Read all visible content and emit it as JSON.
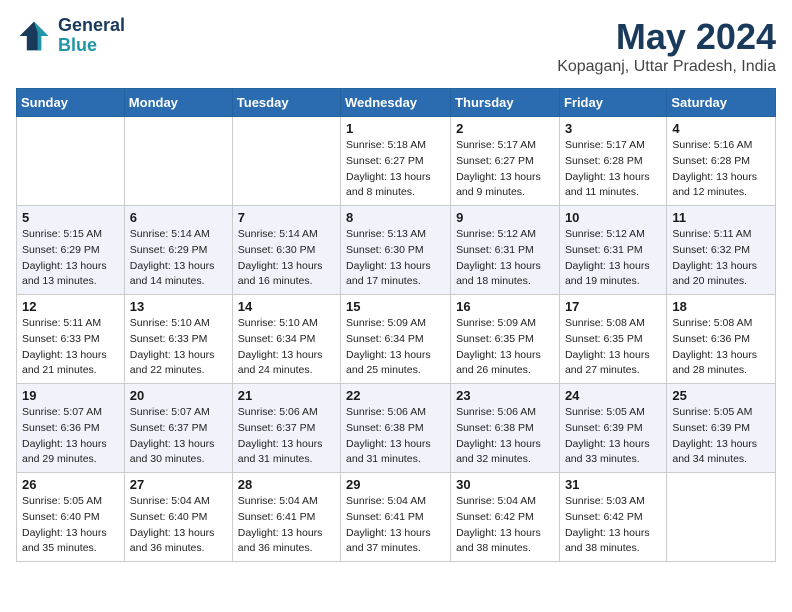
{
  "header": {
    "logo_line1": "General",
    "logo_line2": "Blue",
    "month": "May 2024",
    "location": "Kopaganj, Uttar Pradesh, India"
  },
  "weekdays": [
    "Sunday",
    "Monday",
    "Tuesday",
    "Wednesday",
    "Thursday",
    "Friday",
    "Saturday"
  ],
  "weeks": [
    [
      {
        "day": "",
        "info": ""
      },
      {
        "day": "",
        "info": ""
      },
      {
        "day": "",
        "info": ""
      },
      {
        "day": "1",
        "info": "Sunrise: 5:18 AM\nSunset: 6:27 PM\nDaylight: 13 hours\nand 8 minutes."
      },
      {
        "day": "2",
        "info": "Sunrise: 5:17 AM\nSunset: 6:27 PM\nDaylight: 13 hours\nand 9 minutes."
      },
      {
        "day": "3",
        "info": "Sunrise: 5:17 AM\nSunset: 6:28 PM\nDaylight: 13 hours\nand 11 minutes."
      },
      {
        "day": "4",
        "info": "Sunrise: 5:16 AM\nSunset: 6:28 PM\nDaylight: 13 hours\nand 12 minutes."
      }
    ],
    [
      {
        "day": "5",
        "info": "Sunrise: 5:15 AM\nSunset: 6:29 PM\nDaylight: 13 hours\nand 13 minutes."
      },
      {
        "day": "6",
        "info": "Sunrise: 5:14 AM\nSunset: 6:29 PM\nDaylight: 13 hours\nand 14 minutes."
      },
      {
        "day": "7",
        "info": "Sunrise: 5:14 AM\nSunset: 6:30 PM\nDaylight: 13 hours\nand 16 minutes."
      },
      {
        "day": "8",
        "info": "Sunrise: 5:13 AM\nSunset: 6:30 PM\nDaylight: 13 hours\nand 17 minutes."
      },
      {
        "day": "9",
        "info": "Sunrise: 5:12 AM\nSunset: 6:31 PM\nDaylight: 13 hours\nand 18 minutes."
      },
      {
        "day": "10",
        "info": "Sunrise: 5:12 AM\nSunset: 6:31 PM\nDaylight: 13 hours\nand 19 minutes."
      },
      {
        "day": "11",
        "info": "Sunrise: 5:11 AM\nSunset: 6:32 PM\nDaylight: 13 hours\nand 20 minutes."
      }
    ],
    [
      {
        "day": "12",
        "info": "Sunrise: 5:11 AM\nSunset: 6:33 PM\nDaylight: 13 hours\nand 21 minutes."
      },
      {
        "day": "13",
        "info": "Sunrise: 5:10 AM\nSunset: 6:33 PM\nDaylight: 13 hours\nand 22 minutes."
      },
      {
        "day": "14",
        "info": "Sunrise: 5:10 AM\nSunset: 6:34 PM\nDaylight: 13 hours\nand 24 minutes."
      },
      {
        "day": "15",
        "info": "Sunrise: 5:09 AM\nSunset: 6:34 PM\nDaylight: 13 hours\nand 25 minutes."
      },
      {
        "day": "16",
        "info": "Sunrise: 5:09 AM\nSunset: 6:35 PM\nDaylight: 13 hours\nand 26 minutes."
      },
      {
        "day": "17",
        "info": "Sunrise: 5:08 AM\nSunset: 6:35 PM\nDaylight: 13 hours\nand 27 minutes."
      },
      {
        "day": "18",
        "info": "Sunrise: 5:08 AM\nSunset: 6:36 PM\nDaylight: 13 hours\nand 28 minutes."
      }
    ],
    [
      {
        "day": "19",
        "info": "Sunrise: 5:07 AM\nSunset: 6:36 PM\nDaylight: 13 hours\nand 29 minutes."
      },
      {
        "day": "20",
        "info": "Sunrise: 5:07 AM\nSunset: 6:37 PM\nDaylight: 13 hours\nand 30 minutes."
      },
      {
        "day": "21",
        "info": "Sunrise: 5:06 AM\nSunset: 6:37 PM\nDaylight: 13 hours\nand 31 minutes."
      },
      {
        "day": "22",
        "info": "Sunrise: 5:06 AM\nSunset: 6:38 PM\nDaylight: 13 hours\nand 31 minutes."
      },
      {
        "day": "23",
        "info": "Sunrise: 5:06 AM\nSunset: 6:38 PM\nDaylight: 13 hours\nand 32 minutes."
      },
      {
        "day": "24",
        "info": "Sunrise: 5:05 AM\nSunset: 6:39 PM\nDaylight: 13 hours\nand 33 minutes."
      },
      {
        "day": "25",
        "info": "Sunrise: 5:05 AM\nSunset: 6:39 PM\nDaylight: 13 hours\nand 34 minutes."
      }
    ],
    [
      {
        "day": "26",
        "info": "Sunrise: 5:05 AM\nSunset: 6:40 PM\nDaylight: 13 hours\nand 35 minutes."
      },
      {
        "day": "27",
        "info": "Sunrise: 5:04 AM\nSunset: 6:40 PM\nDaylight: 13 hours\nand 36 minutes."
      },
      {
        "day": "28",
        "info": "Sunrise: 5:04 AM\nSunset: 6:41 PM\nDaylight: 13 hours\nand 36 minutes."
      },
      {
        "day": "29",
        "info": "Sunrise: 5:04 AM\nSunset: 6:41 PM\nDaylight: 13 hours\nand 37 minutes."
      },
      {
        "day": "30",
        "info": "Sunrise: 5:04 AM\nSunset: 6:42 PM\nDaylight: 13 hours\nand 38 minutes."
      },
      {
        "day": "31",
        "info": "Sunrise: 5:03 AM\nSunset: 6:42 PM\nDaylight: 13 hours\nand 38 minutes."
      },
      {
        "day": "",
        "info": ""
      }
    ]
  ]
}
